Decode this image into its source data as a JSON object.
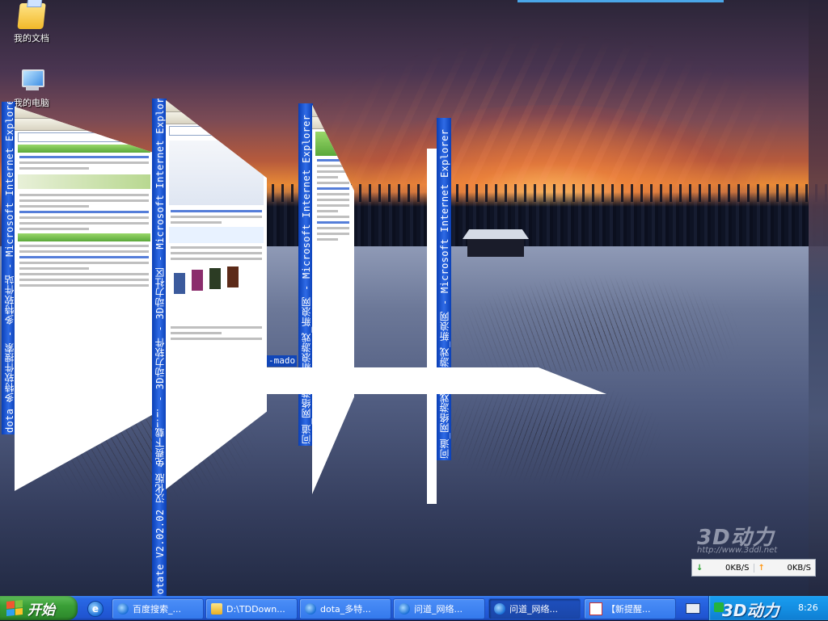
{
  "desktop": {
    "icons": [
      {
        "label": "我的文档",
        "icon": "my-documents-folder-icon"
      },
      {
        "label": "我的电脑",
        "icon": "my-computer-icon"
      }
    ]
  },
  "switcher": {
    "windows": [
      {
        "title": "dota_多特软件搜索 - 多特软件站 - Microsoft Internet Explorer"
      },
      {
        "title": "otate V2.02.02 汉化版 免费下载！！ - 3D动力软件 - 3D动力社区 - Microsoft Internet Explorer"
      },
      {
        "title": "问道_网络游戏_新浪游戏_新浪网 - Microsoft Internet Explorer"
      },
      {
        "title": "问道_网络游戏_新浪游戏_新浪网 - Microsoft Internet Explorer"
      }
    ],
    "stripe_label": "-mado"
  },
  "watermark": {
    "logo": "3D动力",
    "url": "http://www.3ddl.net"
  },
  "netspeed": {
    "down_label": "0KB/S",
    "up_label": "0KB/S"
  },
  "taskbar": {
    "start_label": "开始",
    "tasks": [
      {
        "label": "百度搜索_...",
        "icon": "ie-icon",
        "active": false
      },
      {
        "label": "D:\\TDDown...",
        "icon": "folder-icon",
        "active": false
      },
      {
        "label": "dota_多特...",
        "icon": "ie-icon",
        "active": false
      },
      {
        "label": "问道_网络...",
        "icon": "ie-icon",
        "active": false
      },
      {
        "label": "问道_网络...",
        "icon": "ie-icon",
        "active": true
      },
      {
        "label": "【新提醒...",
        "icon": "message-icon",
        "active": false
      }
    ],
    "tray_logo": "3D动力",
    "clock": "8:26"
  },
  "colors": {
    "taskbar_blue": "#245ddb",
    "start_green": "#3a9f37",
    "title_blue": "#0a3fb6",
    "tray_blue": "#148fe3"
  }
}
